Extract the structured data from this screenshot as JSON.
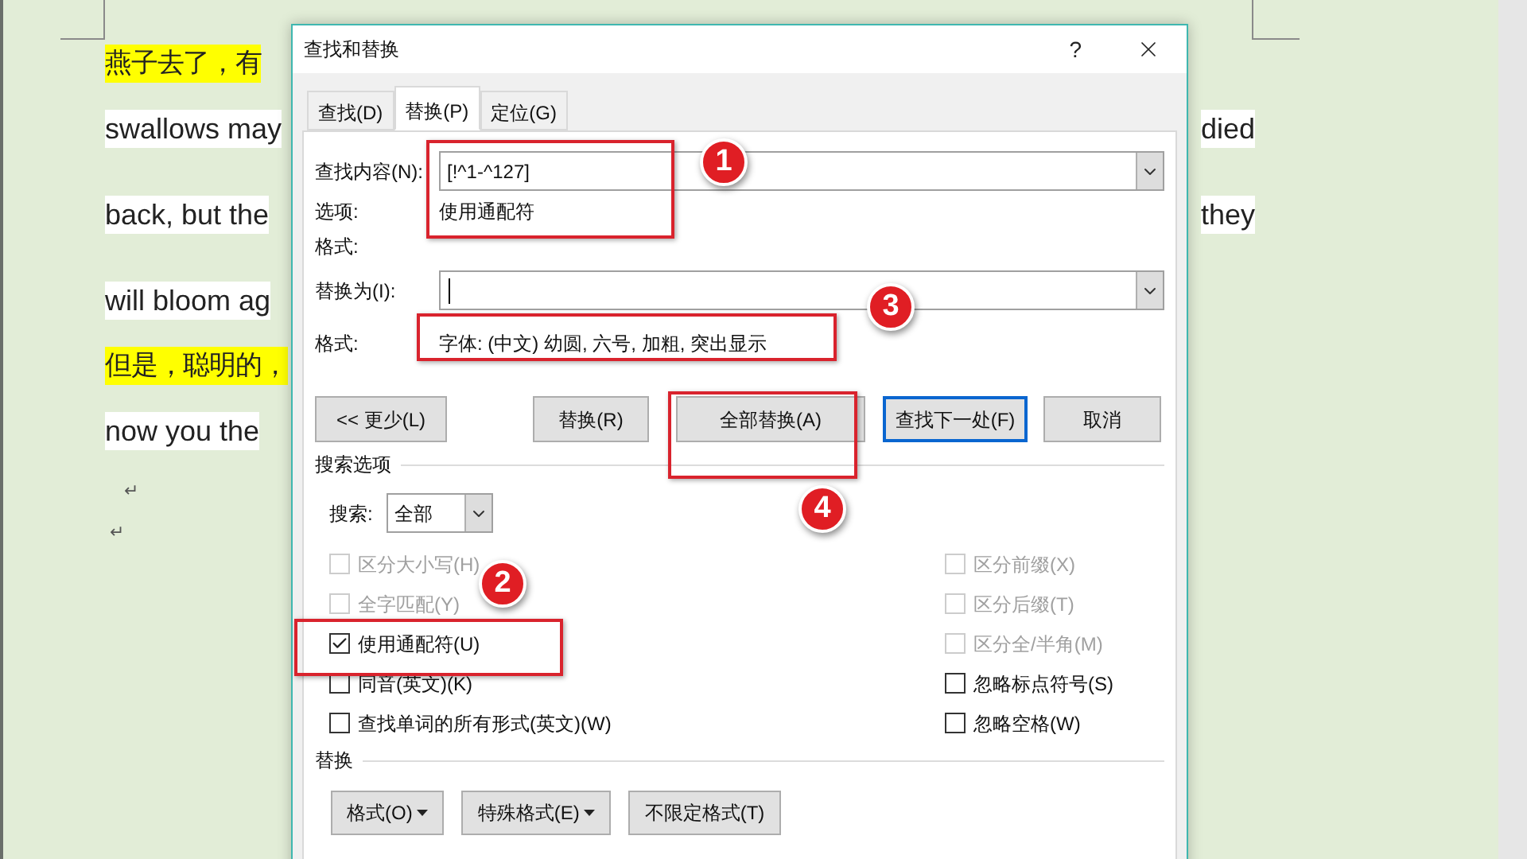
{
  "document": {
    "lines": [
      {
        "text": "燕子去了，有",
        "highlighted": true,
        "kind": "zh"
      },
      {
        "text": "swallows may",
        "highlighted": false,
        "kind": "en",
        "right_text": "died"
      },
      {
        "text": "back, but the",
        "highlighted": false,
        "kind": "en",
        "right_text": "they"
      },
      {
        "text": "will bloom ag",
        "highlighted": false,
        "kind": "en"
      },
      {
        "text": "但是，聪明的，",
        "highlighted": true,
        "kind": "zh"
      },
      {
        "text": "now you the",
        "highlighted": false,
        "kind": "en"
      }
    ],
    "paragraph_marks": [
      "↵",
      "↵"
    ]
  },
  "dialog": {
    "title": "查找和替换",
    "help": "?",
    "tabs": [
      {
        "label": "查找(D)",
        "selected": false
      },
      {
        "label": "替换(P)",
        "selected": true
      },
      {
        "label": "定位(G)",
        "selected": false
      }
    ],
    "find": {
      "label": "查找内容(N):",
      "value": "[!^1-^127]"
    },
    "options": {
      "label": "选项:",
      "value": "使用通配符"
    },
    "find_format": {
      "label": "格式:"
    },
    "replace": {
      "label": "替换为(I):"
    },
    "replace_format": {
      "label": "格式:",
      "value": "字体: (中文) 幼圆, 六号, 加粗, 突出显示"
    },
    "buttons": [
      {
        "label": "<< 更少(L)",
        "default": false
      },
      {
        "label": "替换(R)",
        "default": false
      },
      {
        "label": "全部替换(A)",
        "default": false
      },
      {
        "label": "查找下一处(F)",
        "default": true
      },
      {
        "label": "取消",
        "default": false
      }
    ],
    "search_options": {
      "title": "搜索选项",
      "search_label": "搜索:",
      "search_value": "全部",
      "left": [
        {
          "label": "区分大小写(H)",
          "checked": false,
          "disabled": true
        },
        {
          "label": "全字匹配(Y)",
          "checked": false,
          "disabled": true
        },
        {
          "label": "使用通配符(U)",
          "checked": true,
          "disabled": false
        },
        {
          "label": "同音(英文)(K)",
          "checked": false,
          "disabled": false
        },
        {
          "label": "查找单词的所有形式(英文)(W)",
          "checked": false,
          "disabled": false
        }
      ],
      "right": [
        {
          "label": "区分前缀(X)",
          "checked": false,
          "disabled": true
        },
        {
          "label": "区分后缀(T)",
          "checked": false,
          "disabled": true
        },
        {
          "label": "区分全/半角(M)",
          "checked": false,
          "disabled": true
        },
        {
          "label": "忽略标点符号(S)",
          "checked": false,
          "disabled": false
        },
        {
          "label": "忽略空格(W)",
          "checked": false,
          "disabled": false
        }
      ]
    },
    "replace_section": {
      "title": "替换",
      "buttons": [
        {
          "label": "格式(O)",
          "dropdown": true
        },
        {
          "label": "特殊格式(E)",
          "dropdown": true
        },
        {
          "label": "不限定格式(T)",
          "dropdown": false
        }
      ]
    }
  },
  "annotations": [
    {
      "number": "1"
    },
    {
      "number": "2"
    },
    {
      "number": "3"
    },
    {
      "number": "4"
    }
  ]
}
